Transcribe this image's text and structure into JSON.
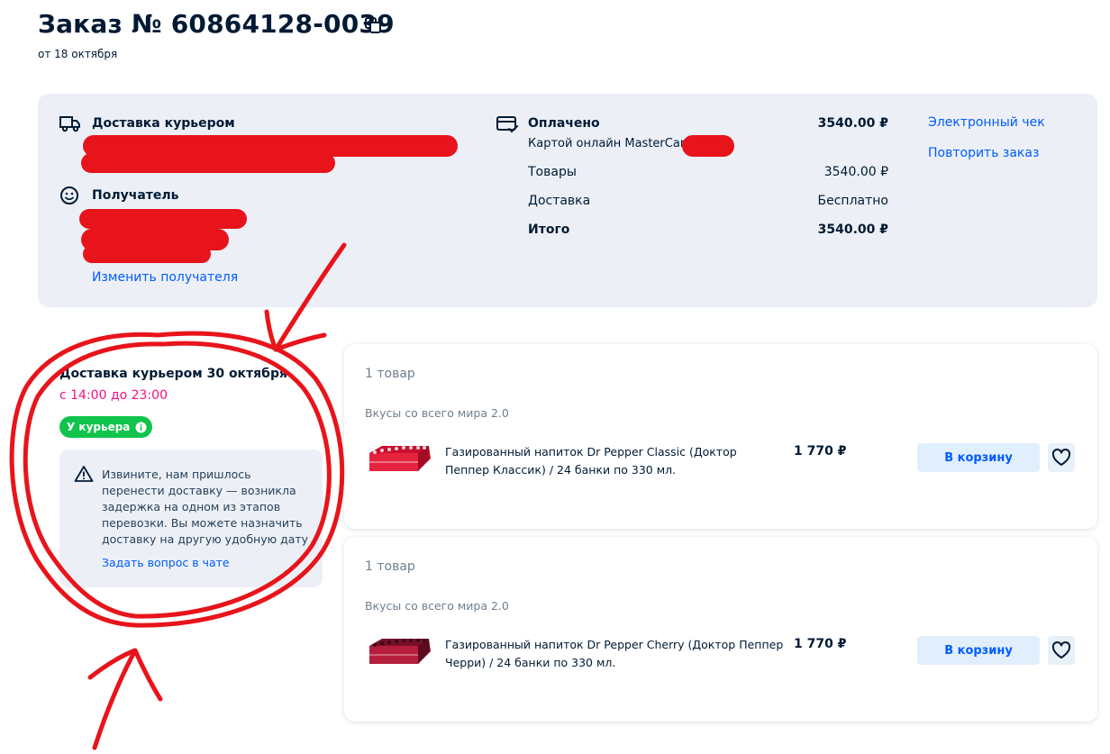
{
  "order": {
    "title": "Заказ № 60864128-0039",
    "date": "от 18 октября"
  },
  "delivery": {
    "method": "Доставка курьером",
    "recipient_label": "Получатель",
    "change_recipient": "Изменить получателя"
  },
  "payment": {
    "status": "Оплачено",
    "amount": "3540.00 ₽",
    "method": "Картой онлайн MasterCard",
    "items_label": "Товары",
    "items_value": "3540.00 ₽",
    "shipping_label": "Доставка",
    "shipping_value": "Бесплатно",
    "total_label": "Итого",
    "total_value": "3540.00 ₽"
  },
  "actions": {
    "receipt": "Электронный чек",
    "repeat": "Повторить заказ"
  },
  "shipment": {
    "title": "Доставка курьером 30 октября",
    "time": "с 14:00 до 23:00",
    "badge": "У курьера",
    "notice": "Извините, нам пришлось перенести доставку — возникла задержка на одном из этапов перевозки. Вы можете назначить доставку на другую удобную дату",
    "chat_link": "Задать вопрос в чате"
  },
  "products": [
    {
      "count": "1 товар",
      "seller": "Вкусы со всего мира 2.0",
      "name": "Газированный напиток Dr Pepper Classic (Доктор Пеппер Классик) / 24 банки по 330 мл.",
      "price": "1 770 ₽",
      "cart_button": "В корзину"
    },
    {
      "count": "1 товар",
      "seller": "Вкусы со всего мира 2.0",
      "name": "Газированный напиток Dr Pepper Cherry (Доктор Пеппер Черри) / 24 банки по 330 мл.",
      "price": "1 770 ₽",
      "cart_button": "В корзину"
    }
  ],
  "colors": {
    "accent_blue": "#005bff",
    "badge_green": "#10c44c",
    "time_red": "#f1117e",
    "annotation_red": "#e8141b"
  }
}
